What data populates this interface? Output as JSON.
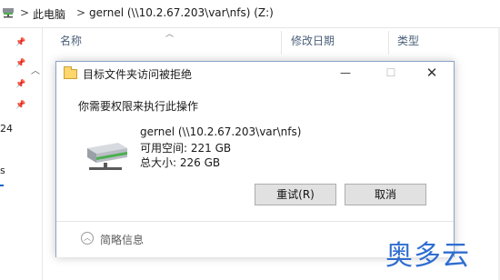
{
  "address_bar": {
    "crumbs": [
      "此电脑",
      "gernel (\\\\10.2.67.203\\var\\nfs) (Z:)"
    ],
    "separator": ">"
  },
  "navpane": {
    "frag1": "24",
    "frag2": "s"
  },
  "columns": {
    "name": "名称",
    "date": "修改日期",
    "type": "类型"
  },
  "dialog": {
    "title": "目标文件夹访问被拒绝",
    "minimize": "—",
    "maximize": "☐",
    "close": "✕",
    "heading": "你需要权限来执行此操作",
    "drive": {
      "name": "gernel (\\\\10.2.67.203\\var\\nfs)",
      "free": "可用空间: 221 GB",
      "total": "总大小: 226 GB"
    },
    "buttons": {
      "retry": "重试(R)",
      "cancel": "取消"
    },
    "footer": {
      "toggle_icon": "chevron-up-circle-icon",
      "details": "简略信息"
    }
  },
  "watermark": "奥多云",
  "icons": {
    "pins": [
      "pin-icon",
      "pin-icon",
      "pin-icon",
      "pin-icon"
    ],
    "address": "network-drive-icon",
    "dialog_drive": "network-drive-icon",
    "title": "folder-icon"
  }
}
